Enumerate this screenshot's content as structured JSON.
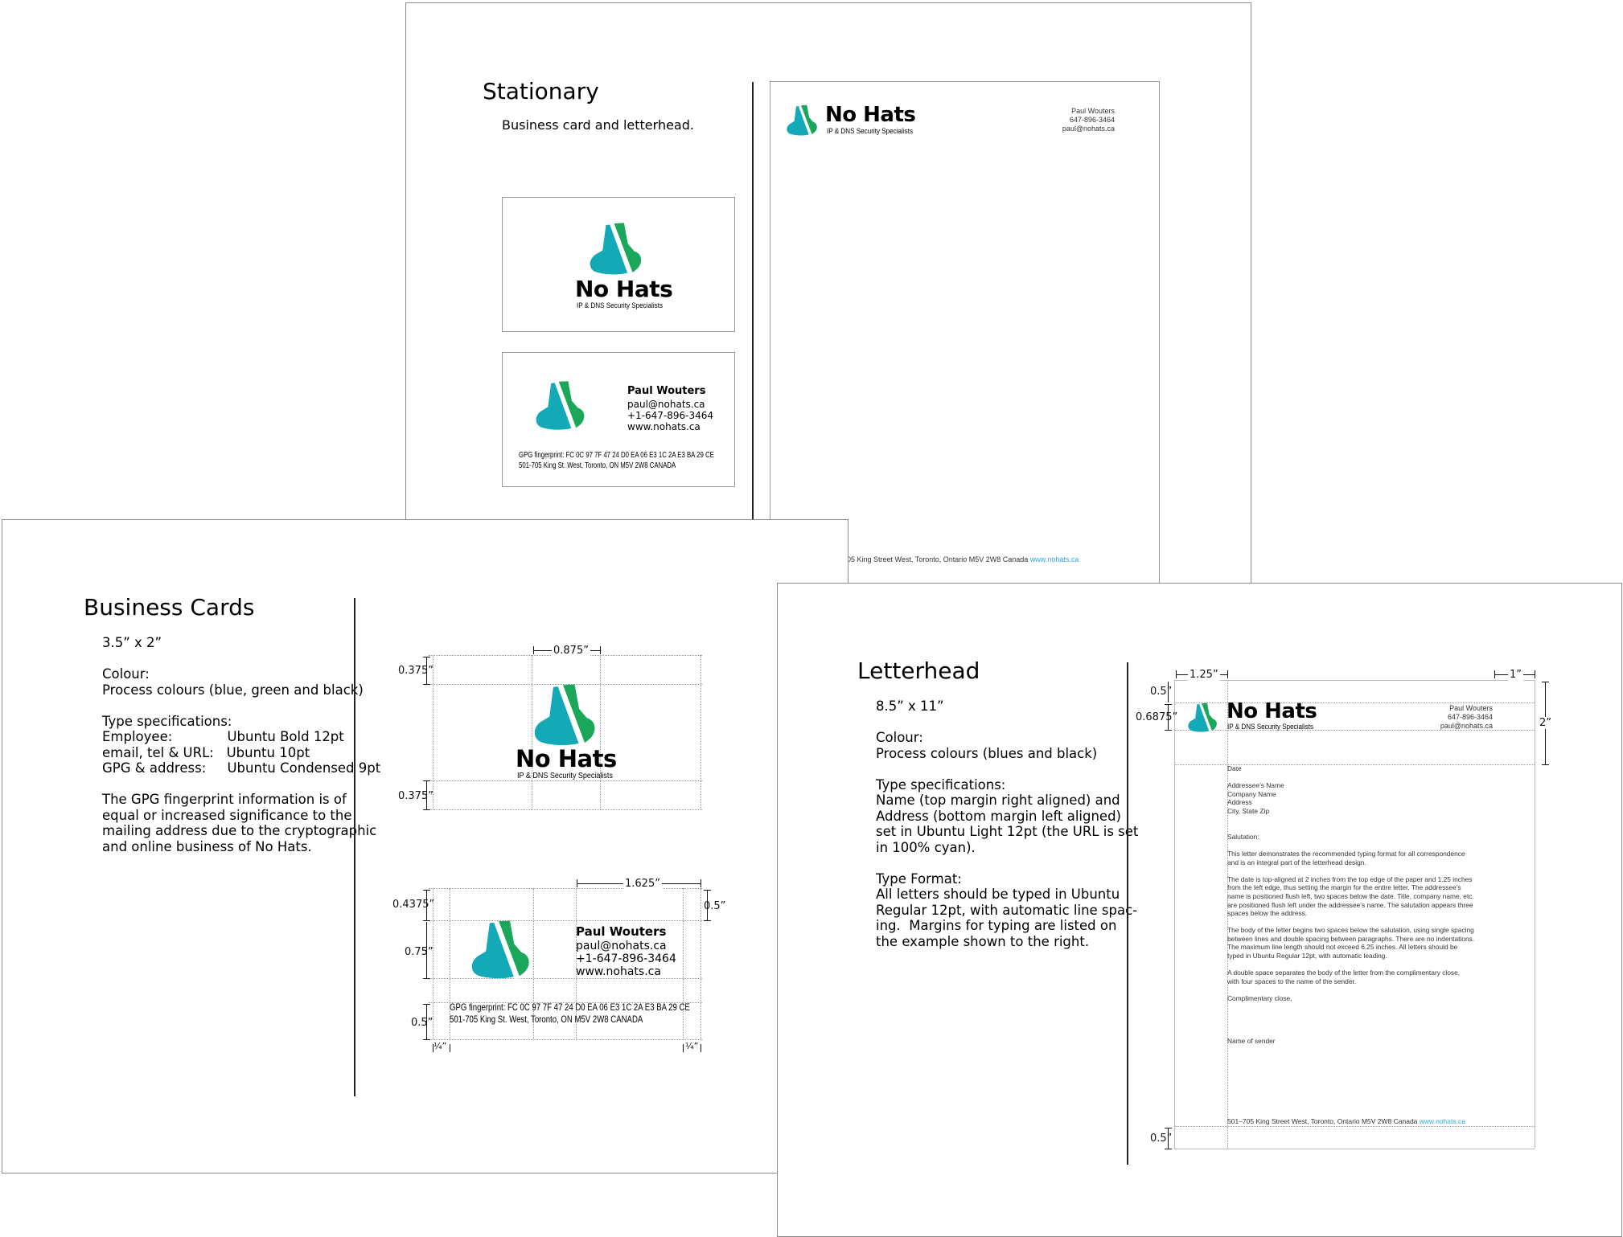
{
  "brand": {
    "name": "No Hats",
    "tagline": "IP & DNS Security Specialists",
    "colors": {
      "green": "#1aa75a",
      "teal": "#13a9b6",
      "accent_url": "#29a8e0"
    }
  },
  "stationary": {
    "title": "Stationary",
    "subtitle": "Business card and letterhead.",
    "card_back": {
      "name": "Paul Wouters",
      "email": "paul@nohats.ca",
      "phone": "+1-647-896-3464",
      "web": "www.nohats.ca",
      "gpg": "GPG fingerprint: FC 0C 97 7F 47 24 D0 EA  06 E3 1C 2A E3 BA 29 CE",
      "address": "501-705 King St. West, Toronto, ON  M5V 2W8 CANADA"
    },
    "letterhead": {
      "name": "Paul Wouters",
      "phone": "647-896-3464",
      "email": "paul@nohats.ca",
      "footer_address": "05 King Street West, Toronto, Ontario  M5V 2W8  Canada",
      "footer_url": "www.nohats.ca"
    }
  },
  "business_cards": {
    "title": "Business Cards",
    "specs": "3.5” x 2”\n\nColour:\nProcess colours (blue, green and black)\n\nType specifications:\nEmployee:             Ubuntu Bold 12pt\nemail, tel & URL:   Ubuntu 10pt\nGPG & address:     Ubuntu Condensed 9pt\n\nThe GPG fingerprint information is of\nequal or increased significance to the\nmailing address due to the cryptographic\nand online business of No Hats.",
    "front_dims": {
      "top_margin": "0.375”",
      "bottom_margin": "0.375”",
      "logo_width": "0.875”"
    },
    "back_dims": {
      "top": "0.4375”",
      "logo_height": "0.75”",
      "bottom": "0.5”",
      "text_width": "1.625”",
      "right_top": "0.5”",
      "left_edge": "¼”",
      "right_edge": "¼”"
    },
    "card": {
      "name": "Paul Wouters",
      "email": "paul@nohats.ca",
      "phone": "+1-647-896-3464",
      "web": "www.nohats.ca",
      "gpg": "GPG fingerprint: FC 0C 97 7F 47 24 D0 EA  06 E3 1C 2A E3 BA 29 CE",
      "address": "501-705 King St. West, Toronto, ON  M5V 2W8 CANADA"
    }
  },
  "letterhead": {
    "title": "Letterhead",
    "specs": "8.5” x 11”\n\nColour:\nProcess colours (blues and black)\n\nType specifications:\nName (top margin right aligned) and\nAddress (bottom margin left aligned)\nset in Ubuntu Light 12pt (the URL is set\nin 100% cyan).\n\nType Format:\nAll letters should be typed in Ubuntu\nRegular 12pt, with automatic line spac-\ning.  Margins for typing are listed on\nthe example shown to the right.",
    "dims": {
      "left": "1.25”",
      "right": "1”",
      "top": "0.5”",
      "logo": "0.6875”",
      "header": "2”",
      "bottom": "0.5”"
    },
    "sample": {
      "name": "Paul Wouters",
      "phone": "647-896-3464",
      "email": "paul@nohats.ca",
      "body": "Date\n\nAddressee’s Name\nCompany Name\nAddress\nCity, State Zip\n\n\nSalutation:\n\nThis letter demonstrates the recommended typing format for all correspondence\nand is an integral part of the letterhead design.\n\nThe date is top-aligned at 2 inches from the top edge of the paper and 1.25 inches\nfrom the left edge, thus setting the margin for the entire letter. The addressee’s\nname is positioned flush left, two spaces below the date. Title, company name, etc.\nare positioned flush left under the addressee’s name. The salutation appears three\nspaces below the address.\n\nThe body of the letter begins two spaces below the salutation, using single spacing\nbetween lines and double spacing between paragraphs. There are no indentations.\nThe maximum line length should not exceed 6.25 inches. All letters should be\ntyped in Ubuntu Regular 12pt, with automatic leading.\n\nA double space separates the body of the letter from the complimentary close,\nwith four spaces to the name of the sender.\n\nComplimentary close,\n\n\n\n\nName of sender",
      "footer_address": "501–705 King Street West, Toronto, Ontario  M5V 2W8  Canada",
      "footer_url": "www.nohats.ca"
    }
  }
}
